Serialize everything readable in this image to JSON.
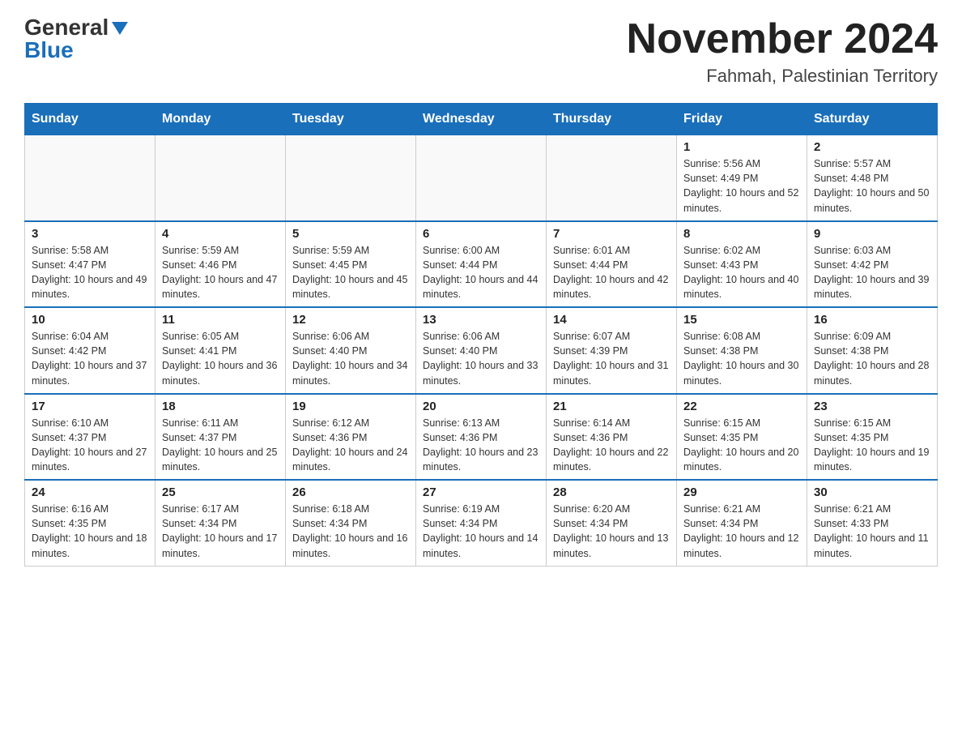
{
  "header": {
    "logo_general": "General",
    "logo_blue": "Blue",
    "main_title": "November 2024",
    "subtitle": "Fahmah, Palestinian Territory"
  },
  "calendar": {
    "days_of_week": [
      "Sunday",
      "Monday",
      "Tuesday",
      "Wednesday",
      "Thursday",
      "Friday",
      "Saturday"
    ],
    "weeks": [
      [
        {
          "day": "",
          "info": ""
        },
        {
          "day": "",
          "info": ""
        },
        {
          "day": "",
          "info": ""
        },
        {
          "day": "",
          "info": ""
        },
        {
          "day": "",
          "info": ""
        },
        {
          "day": "1",
          "info": "Sunrise: 5:56 AM\nSunset: 4:49 PM\nDaylight: 10 hours and 52 minutes."
        },
        {
          "day": "2",
          "info": "Sunrise: 5:57 AM\nSunset: 4:48 PM\nDaylight: 10 hours and 50 minutes."
        }
      ],
      [
        {
          "day": "3",
          "info": "Sunrise: 5:58 AM\nSunset: 4:47 PM\nDaylight: 10 hours and 49 minutes."
        },
        {
          "day": "4",
          "info": "Sunrise: 5:59 AM\nSunset: 4:46 PM\nDaylight: 10 hours and 47 minutes."
        },
        {
          "day": "5",
          "info": "Sunrise: 5:59 AM\nSunset: 4:45 PM\nDaylight: 10 hours and 45 minutes."
        },
        {
          "day": "6",
          "info": "Sunrise: 6:00 AM\nSunset: 4:44 PM\nDaylight: 10 hours and 44 minutes."
        },
        {
          "day": "7",
          "info": "Sunrise: 6:01 AM\nSunset: 4:44 PM\nDaylight: 10 hours and 42 minutes."
        },
        {
          "day": "8",
          "info": "Sunrise: 6:02 AM\nSunset: 4:43 PM\nDaylight: 10 hours and 40 minutes."
        },
        {
          "day": "9",
          "info": "Sunrise: 6:03 AM\nSunset: 4:42 PM\nDaylight: 10 hours and 39 minutes."
        }
      ],
      [
        {
          "day": "10",
          "info": "Sunrise: 6:04 AM\nSunset: 4:42 PM\nDaylight: 10 hours and 37 minutes."
        },
        {
          "day": "11",
          "info": "Sunrise: 6:05 AM\nSunset: 4:41 PM\nDaylight: 10 hours and 36 minutes."
        },
        {
          "day": "12",
          "info": "Sunrise: 6:06 AM\nSunset: 4:40 PM\nDaylight: 10 hours and 34 minutes."
        },
        {
          "day": "13",
          "info": "Sunrise: 6:06 AM\nSunset: 4:40 PM\nDaylight: 10 hours and 33 minutes."
        },
        {
          "day": "14",
          "info": "Sunrise: 6:07 AM\nSunset: 4:39 PM\nDaylight: 10 hours and 31 minutes."
        },
        {
          "day": "15",
          "info": "Sunrise: 6:08 AM\nSunset: 4:38 PM\nDaylight: 10 hours and 30 minutes."
        },
        {
          "day": "16",
          "info": "Sunrise: 6:09 AM\nSunset: 4:38 PM\nDaylight: 10 hours and 28 minutes."
        }
      ],
      [
        {
          "day": "17",
          "info": "Sunrise: 6:10 AM\nSunset: 4:37 PM\nDaylight: 10 hours and 27 minutes."
        },
        {
          "day": "18",
          "info": "Sunrise: 6:11 AM\nSunset: 4:37 PM\nDaylight: 10 hours and 25 minutes."
        },
        {
          "day": "19",
          "info": "Sunrise: 6:12 AM\nSunset: 4:36 PM\nDaylight: 10 hours and 24 minutes."
        },
        {
          "day": "20",
          "info": "Sunrise: 6:13 AM\nSunset: 4:36 PM\nDaylight: 10 hours and 23 minutes."
        },
        {
          "day": "21",
          "info": "Sunrise: 6:14 AM\nSunset: 4:36 PM\nDaylight: 10 hours and 22 minutes."
        },
        {
          "day": "22",
          "info": "Sunrise: 6:15 AM\nSunset: 4:35 PM\nDaylight: 10 hours and 20 minutes."
        },
        {
          "day": "23",
          "info": "Sunrise: 6:15 AM\nSunset: 4:35 PM\nDaylight: 10 hours and 19 minutes."
        }
      ],
      [
        {
          "day": "24",
          "info": "Sunrise: 6:16 AM\nSunset: 4:35 PM\nDaylight: 10 hours and 18 minutes."
        },
        {
          "day": "25",
          "info": "Sunrise: 6:17 AM\nSunset: 4:34 PM\nDaylight: 10 hours and 17 minutes."
        },
        {
          "day": "26",
          "info": "Sunrise: 6:18 AM\nSunset: 4:34 PM\nDaylight: 10 hours and 16 minutes."
        },
        {
          "day": "27",
          "info": "Sunrise: 6:19 AM\nSunset: 4:34 PM\nDaylight: 10 hours and 14 minutes."
        },
        {
          "day": "28",
          "info": "Sunrise: 6:20 AM\nSunset: 4:34 PM\nDaylight: 10 hours and 13 minutes."
        },
        {
          "day": "29",
          "info": "Sunrise: 6:21 AM\nSunset: 4:34 PM\nDaylight: 10 hours and 12 minutes."
        },
        {
          "day": "30",
          "info": "Sunrise: 6:21 AM\nSunset: 4:33 PM\nDaylight: 10 hours and 11 minutes."
        }
      ]
    ]
  }
}
